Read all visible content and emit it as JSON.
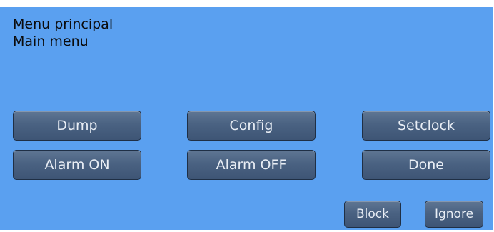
{
  "dialog": {
    "message_lines": [
      "Menu principal",
      "Main menu"
    ],
    "buttons": [
      "Dump",
      "Config",
      "Setclock",
      "Alarm ON",
      "Alarm OFF",
      "Done"
    ],
    "block_label": "Block",
    "ignore_label": "Ignore"
  },
  "colors": {
    "dialog_background": "#5aa0f0",
    "button_fill": "#4a6282",
    "button_text": "#e9eef5"
  }
}
